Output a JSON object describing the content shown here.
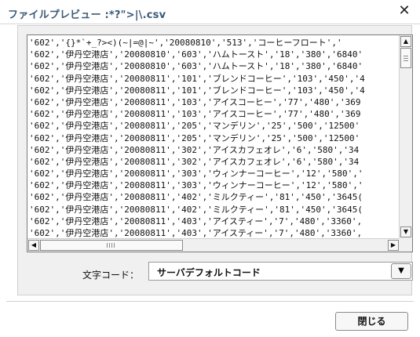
{
  "dialog": {
    "title": "ファイルプレビュー :*?\">|\\.csv",
    "close_glyph": "✕"
  },
  "preview": {
    "lines": [
      "'602','{}*`+_?><)(~|=@|~','20080810','513','コーヒーフロート','",
      "'602','伊丹空港店','20080810','603','ハムトースト','18','380','6840'",
      "'602','伊丹空港店','20080810','603','ハムトースト','18','380','6840'",
      "'602','伊丹空港店','20080811','101','ブレンドコーヒー','103','450','4",
      "'602','伊丹空港店','20080811','101','ブレンドコーヒー','103','450','4",
      "'602','伊丹空港店','20080811','103','アイスコーヒー','77','480','369",
      "'602','伊丹空港店','20080811','103','アイスコーヒー','77','480','369",
      "'602','伊丹空港店','20080811','205','マンデリン','25','500','12500'",
      "'602','伊丹空港店','20080811','205','マンデリン','25','500','12500'",
      "'602','伊丹空港店','20080811','302','アイスカフェオレ','6','580','34",
      "'602','伊丹空港店','20080811','302','アイスカフェオレ','6','580','34",
      "'602','伊丹空港店','20080811','303','ウィンナーコーヒー','12','580','",
      "'602','伊丹空港店','20080811','303','ウィンナーコーヒー','12','580','",
      "'602','伊丹空港店','20080811','402','ミルクティー','81','450','3645(",
      "'602','伊丹空港店','20080811','402','ミルクティー','81','450','3645(",
      "'602','伊丹空港店','20080811','403','アイスティー','7','480','3360',",
      "'602','伊丹空港店','20080811','403','アイスティー','7','480','3360',"
    ]
  },
  "encoding": {
    "label": "文字コード：",
    "value": "サーバデフォルトコード"
  },
  "footer": {
    "close_label": "閉じる"
  }
}
